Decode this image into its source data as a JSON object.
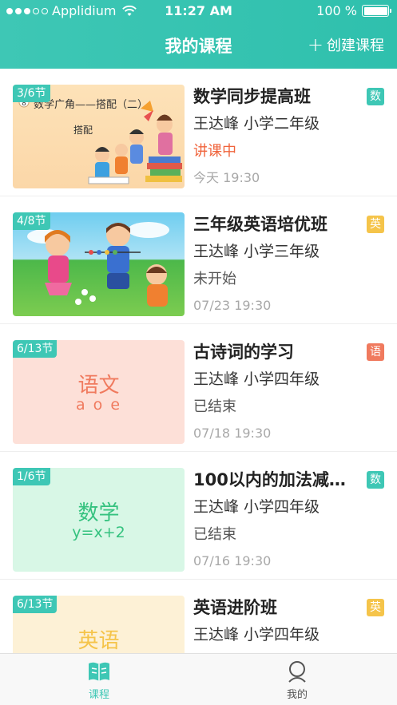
{
  "status_bar": {
    "carrier": "Applidium",
    "time": "11:27 AM",
    "battery": "100 %"
  },
  "nav": {
    "title": "我的课程",
    "create_label": "创建课程"
  },
  "courses": [
    {
      "lessons": "3/6节",
      "title": "数学同步提高班",
      "teacher": "王达峰  小学二年级",
      "status": "讲课中",
      "time": "今天 19:30",
      "tag": "数",
      "thumb_caption": "数学广角——搭配（二）",
      "thumb_sub": "搭配"
    },
    {
      "lessons": "4/8节",
      "title": "三年级英语培优班",
      "teacher": "王达峰  小学三年级",
      "status": "未开始",
      "time": "07/23 19:30",
      "tag": "英"
    },
    {
      "lessons": "6/13节",
      "title": "古诗词的学习",
      "teacher": "王达峰  小学四年级",
      "status": "已结束",
      "time": "07/18 19:30",
      "tag": "语",
      "thumb_title": "语文",
      "thumb_sub": "a o e"
    },
    {
      "lessons": "1/6节",
      "title": "100以内的加法减…",
      "teacher": "王达峰  小学四年级",
      "status": "已结束",
      "time": "07/16 19:30",
      "tag": "数",
      "thumb_title": "数学",
      "thumb_sub": "y=x+2"
    },
    {
      "lessons": "6/13节",
      "title": "英语进阶班",
      "teacher": "王达峰  小学四年级",
      "tag": "英",
      "thumb_title": "英语"
    }
  ],
  "tabs": {
    "courses": "课程",
    "mine": "我的"
  },
  "colors": {
    "accent": "#3ec7b5",
    "status_active": "#f0643c",
    "tag_math": "#3ec7b5",
    "tag_english": "#f5c44a",
    "tag_chinese": "#f07a5e"
  }
}
